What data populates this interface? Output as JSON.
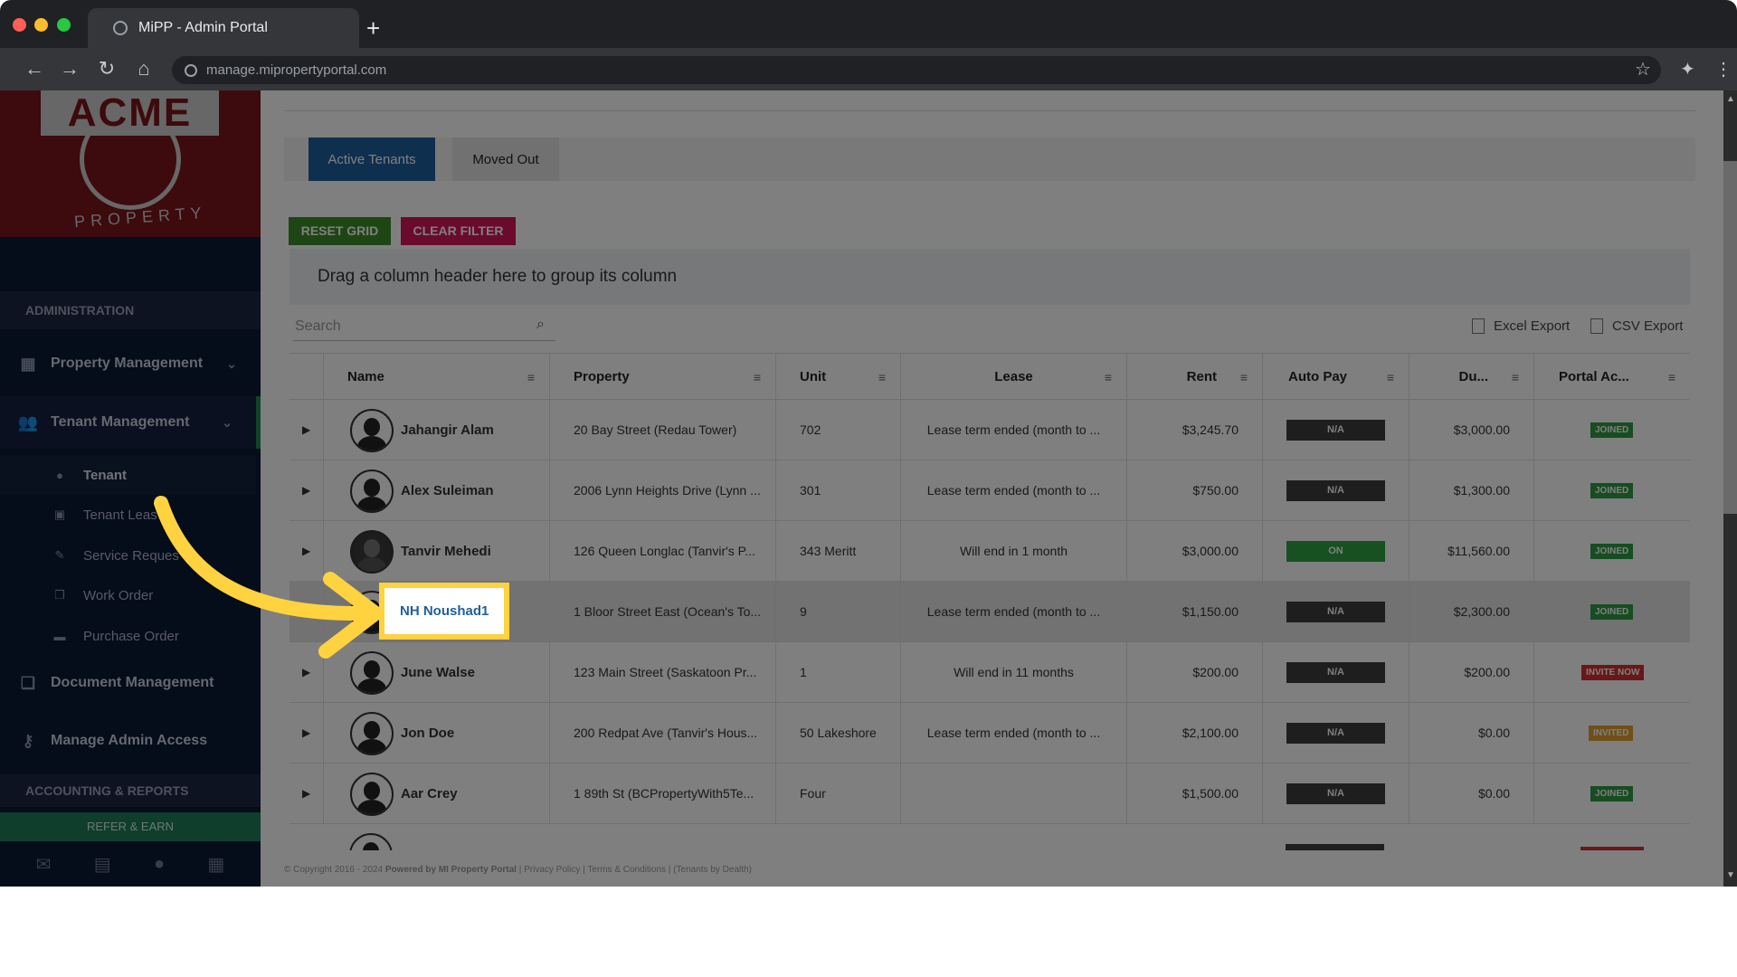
{
  "browser": {
    "tab_title": "MiPP - Admin Portal",
    "url": "manage.mipropertyportal.com"
  },
  "logo": {
    "main": "ACME",
    "sub": "PROPERTY"
  },
  "sidebar": {
    "section_admin": "ADMINISTRATION",
    "items": [
      {
        "label": "Property Management",
        "icon": "building-icon"
      },
      {
        "label": "Tenant Management",
        "icon": "users-icon"
      }
    ],
    "sub_items": [
      {
        "label": "Tenant",
        "icon": "user-icon"
      },
      {
        "label": "Tenant Leas",
        "icon": "calendar-icon"
      },
      {
        "label": "Service Reques",
        "icon": "wrench-icon"
      },
      {
        "label": "Work Order",
        "icon": "copy-icon"
      },
      {
        "label": "Purchase Order",
        "icon": "truck-icon"
      }
    ],
    "doc_mgmt": "Document Management",
    "admin_access": "Manage Admin Access",
    "section_accounting": "ACCOUNTING & REPORTS",
    "refer": "REFER & EARN"
  },
  "tabs": {
    "active": "Active Tenants",
    "moved": "Moved Out"
  },
  "buttons": {
    "reset": "RESET GRID",
    "clear": "CLEAR FILTER"
  },
  "group_hint": "Drag a column header here to group its column",
  "search": {
    "placeholder": "Search"
  },
  "exports": {
    "excel": "Excel Export",
    "csv": "CSV Export"
  },
  "columns": {
    "name": "Name",
    "property": "Property",
    "unit": "Unit",
    "lease": "Lease",
    "rent": "Rent",
    "autopay": "Auto Pay",
    "due": "Du...",
    "portal": "Portal Ac..."
  },
  "rows": [
    {
      "name": "Jahangir Alam",
      "property": "20 Bay Street (Redau Tower)",
      "unit": "702",
      "lease": "Lease term ended (month to ...",
      "rent": "$3,245.70",
      "autopay": "N/A",
      "due": "$3,000.00",
      "portal": "JOINED"
    },
    {
      "name": "Alex Suleiman",
      "property": "2006 Lynn Heights Drive (Lynn ...",
      "unit": "301",
      "lease": "Lease term ended (month to ...",
      "rent": "$750.00",
      "autopay": "N/A",
      "due": "$1,300.00",
      "portal": "JOINED"
    },
    {
      "name": "Tanvir Mehedi",
      "property": "126 Queen Longlac (Tanvir's P...",
      "unit": "343 Meritt",
      "lease": "Will end in 1 month",
      "rent": "$3,000.00",
      "autopay": "ON",
      "due": "$11,560.00",
      "portal": "JOINED"
    },
    {
      "name": "NH Noushad1",
      "property": "1 Bloor Street East (Ocean's To...",
      "unit": "9",
      "lease": "Lease term ended (month to ...",
      "rent": "$1,150.00",
      "autopay": "N/A",
      "due": "$2,300.00",
      "portal": "JOINED"
    },
    {
      "name": "June Walse",
      "property": "123 Main Street (Saskatoon Pr...",
      "unit": "1",
      "lease": "Will end in 11 months",
      "rent": "$200.00",
      "autopay": "N/A",
      "due": "$200.00",
      "portal": "INVITE NOW"
    },
    {
      "name": "Jon Doe",
      "property": "200 Redpat Ave (Tanvir's Hous...",
      "unit": "50 Lakeshore",
      "lease": "Lease term ended (month to ...",
      "rent": "$2,100.00",
      "autopay": "N/A",
      "due": "$0.00",
      "portal": "INVITED"
    },
    {
      "name": "Aar Crey",
      "property": "1 89th St (BCPropertyWith5Te...",
      "unit": "Four",
      "lease": "",
      "rent": "$1,500.00",
      "autopay": "N/A",
      "due": "$0.00",
      "portal": "JOINED"
    }
  ],
  "footer": {
    "copyright": "© Copyright 2016 - 2024",
    "powered": "Powered by MI Property Portal",
    "privacy": "Privacy Policy",
    "terms": "Terms & Conditions",
    "tenants_by": "(Tenants by Dealth)"
  },
  "colors": {
    "accent_blue": "#1e5f9e",
    "reset_green": "#3c8c2a",
    "clear_pink": "#d4145a",
    "highlight_yellow": "#ffd23f"
  }
}
